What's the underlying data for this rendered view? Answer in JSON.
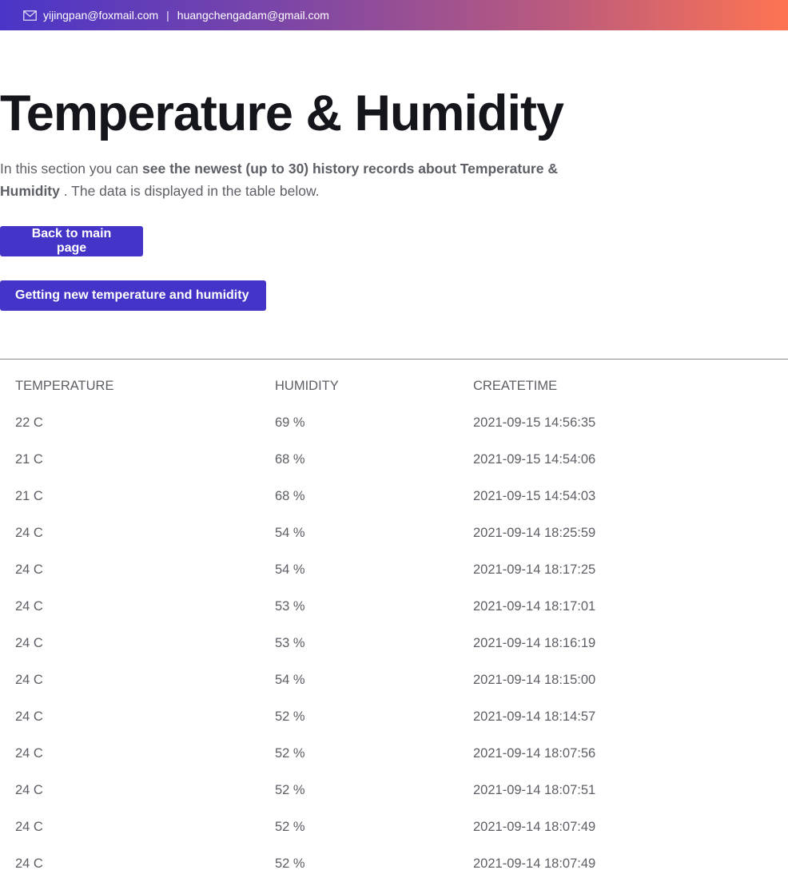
{
  "header": {
    "email_primary": "yijingpan@foxmail.com",
    "separator": "|",
    "email_secondary": "huangchengadam@gmail.com",
    "icon": "mail-icon",
    "gradient": [
      "#4a35c8",
      "#fe7452"
    ]
  },
  "page": {
    "title": "Temperature & Humidity",
    "intro_lead": "In this section you can ",
    "intro_bold": "see the newest (up to 30) history records about Temperature & Humidity",
    "intro_tail": " . The data is displayed in the table below."
  },
  "buttons": {
    "back_label": "Back to main page",
    "new_label": "Getting new temperature and humidity",
    "color": "#4434c7"
  },
  "table": {
    "columns": [
      "TEMPERATURE",
      "HUMIDITY",
      "CREATETIME"
    ],
    "rows": [
      [
        "22 C",
        "69 %",
        "2021-09-15 14:56:35"
      ],
      [
        "21 C",
        "68 %",
        "2021-09-15 14:54:06"
      ],
      [
        "21 C",
        "68 %",
        "2021-09-15 14:54:03"
      ],
      [
        "24 C",
        "54 %",
        "2021-09-14 18:25:59"
      ],
      [
        "24 C",
        "54 %",
        "2021-09-14 18:17:25"
      ],
      [
        "24 C",
        "53 %",
        "2021-09-14 18:17:01"
      ],
      [
        "24 C",
        "53 %",
        "2021-09-14 18:16:19"
      ],
      [
        "24 C",
        "54 %",
        "2021-09-14 18:15:00"
      ],
      [
        "24 C",
        "52 %",
        "2021-09-14 18:14:57"
      ],
      [
        "24 C",
        "52 %",
        "2021-09-14 18:07:56"
      ],
      [
        "24 C",
        "52 %",
        "2021-09-14 18:07:51"
      ],
      [
        "24 C",
        "52 %",
        "2021-09-14 18:07:49"
      ],
      [
        "24 C",
        "52 %",
        "2021-09-14 18:07:49"
      ]
    ]
  }
}
